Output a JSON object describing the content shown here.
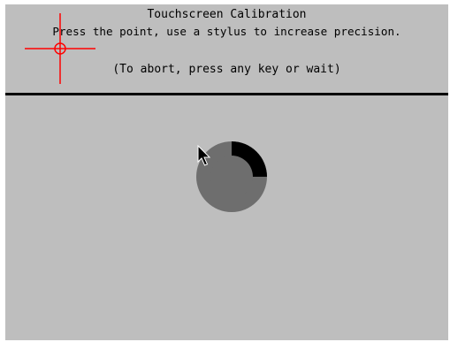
{
  "calibration": {
    "title": "Touchscreen Calibration",
    "instructions": "Press the point, use a stylus to increase precision.",
    "abort_hint": "(To abort, press any key or wait)",
    "timeout_progress": 0.25
  },
  "colors": {
    "background": "#bebebe",
    "target": "#ff0000",
    "timer_remaining": "#6e6e6e",
    "timer_elapsed": "#000000",
    "divider": "#000000"
  },
  "icons": {
    "target": "crosshair-icon",
    "pointer": "mouse-pointer-icon"
  }
}
